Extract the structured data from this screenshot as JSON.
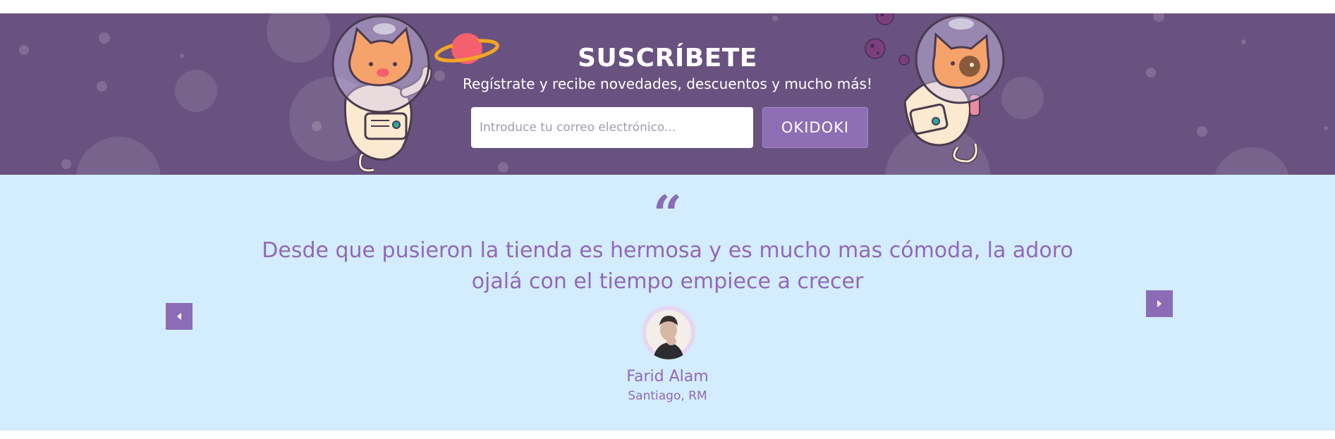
{
  "subscribe": {
    "title": "SUSCRÍBETE",
    "subtitle": "Regístrate y recibe novedades, descuentos y mucho más!",
    "email_placeholder": "Introduce tu correo electrónico...",
    "button_label": "OKIDOKI"
  },
  "testimonial": {
    "quote_mark": "“",
    "quote": "Desde que pusieron la tienda es hermosa y es mucho mas cómoda, la adoro ojalá con el tiempo empiece a crecer",
    "author_name": "Farid Alam",
    "author_location": "Santiago, RM"
  },
  "colors": {
    "band_purple": "#69527f",
    "accent_purple": "#8c6cb7",
    "light_blue": "#d3edfe"
  },
  "icons": {
    "prev": "caret-left-icon",
    "next": "caret-right-icon"
  }
}
